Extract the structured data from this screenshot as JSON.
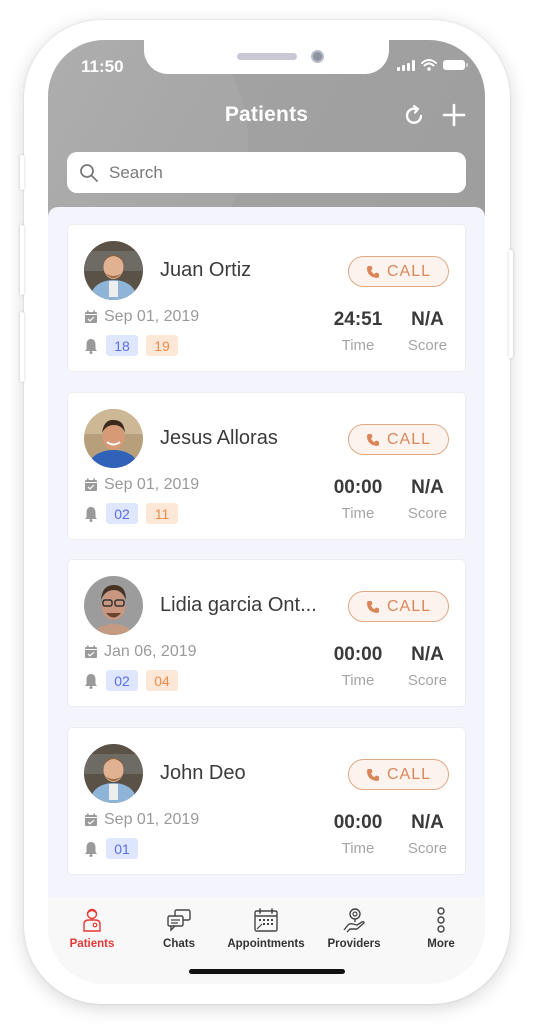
{
  "status_bar": {
    "time": "11:50"
  },
  "header": {
    "title": "Patients"
  },
  "search": {
    "placeholder": "Search",
    "value": ""
  },
  "patients": [
    {
      "name": "Juan Ortiz",
      "date": "Sep 01, 2019",
      "badge_blue": "18",
      "badge_orange": "19",
      "time_value": "24:51",
      "time_label": "Time",
      "score_value": "N/A",
      "score_label": "Score",
      "call_label": "CALL",
      "avatar": "man-light-blue-shirt"
    },
    {
      "name": "Jesus Alloras",
      "date": "Sep 01, 2019",
      "badge_blue": "02",
      "badge_orange": "11",
      "time_value": "00:00",
      "time_label": "Time",
      "score_value": "N/A",
      "score_label": "Score",
      "call_label": "CALL",
      "avatar": "man-blue-tshirt"
    },
    {
      "name": "Lidia garcia Ont...",
      "date": "Jan 06, 2019",
      "badge_blue": "02",
      "badge_orange": "04",
      "time_value": "00:00",
      "time_label": "Time",
      "score_value": "N/A",
      "score_label": "Score",
      "call_label": "CALL",
      "avatar": "man-glasses"
    },
    {
      "name": "John Deo",
      "date": "Sep 01, 2019",
      "badge_blue": "01",
      "badge_orange": null,
      "time_value": "00:00",
      "time_label": "Time",
      "score_value": "N/A",
      "score_label": "Score",
      "call_label": "CALL",
      "avatar": "man-light-blue-shirt"
    }
  ],
  "tabbar": {
    "items": [
      {
        "label": "Patients",
        "icon": "patient-icon",
        "active": true
      },
      {
        "label": "Chats",
        "icon": "chat-icon",
        "active": false
      },
      {
        "label": "Appointments",
        "icon": "calendar-icon",
        "active": false
      },
      {
        "label": "Providers",
        "icon": "provider-icon",
        "active": false
      },
      {
        "label": "More",
        "icon": "more-icon",
        "active": false
      }
    ]
  },
  "colors": {
    "header_bg": "#a3a3a3",
    "accent_call": "#d9875a",
    "active_tab": "#e53935",
    "badge_blue_text": "#5a6ee8",
    "badge_orange_text": "#ec8c4c"
  }
}
